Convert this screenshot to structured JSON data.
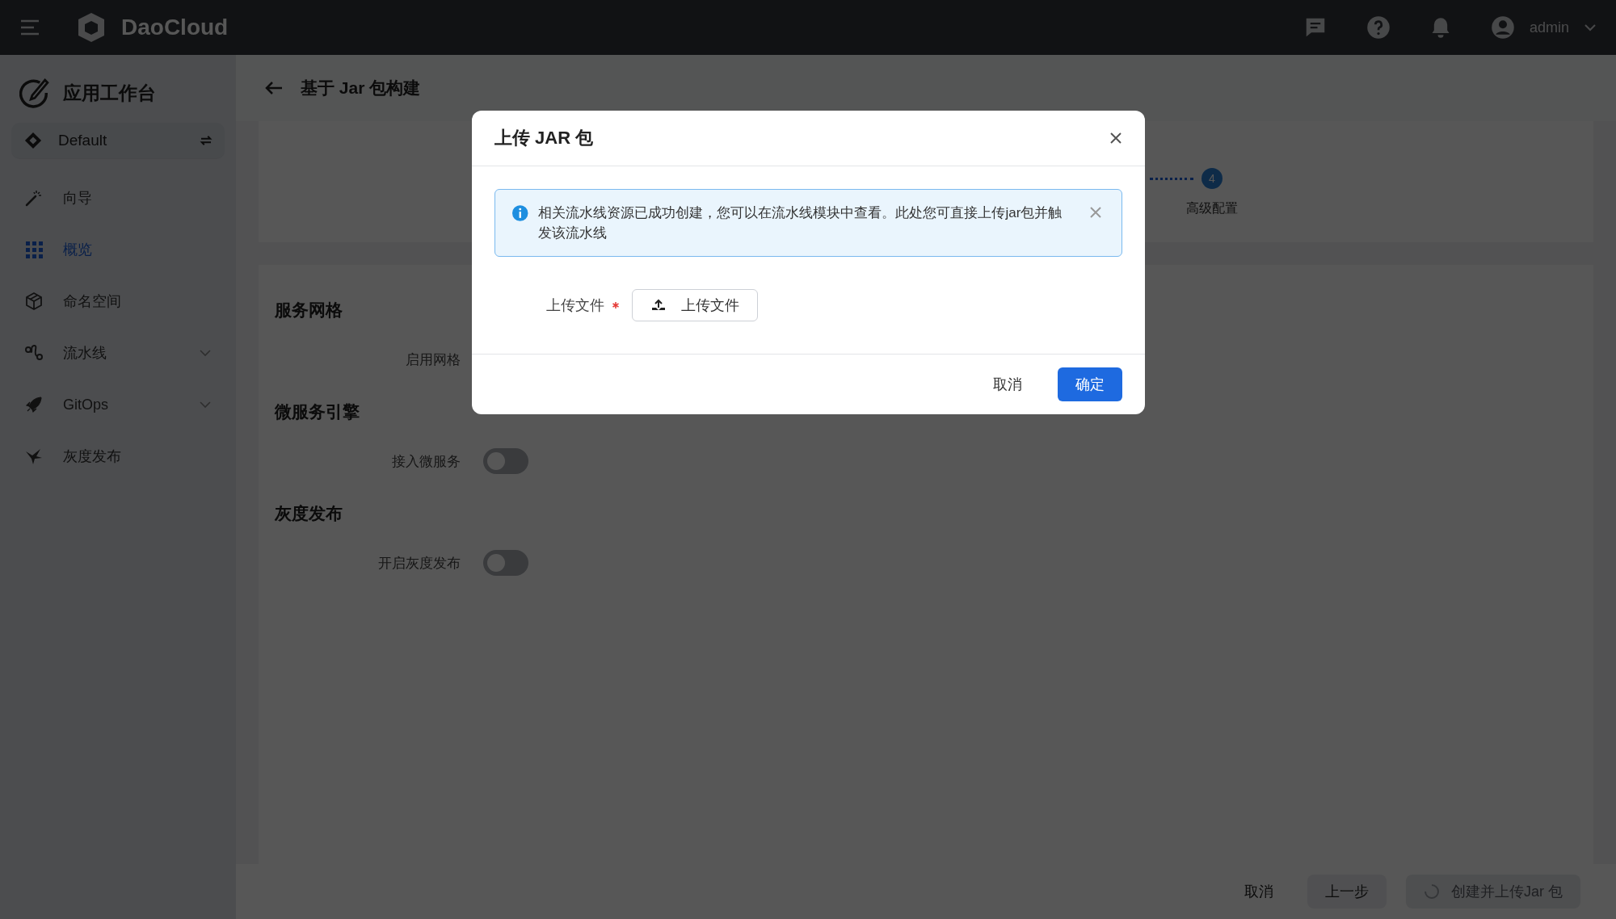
{
  "topbar": {
    "brand": "DaoCloud",
    "user": "admin"
  },
  "sidebar": {
    "title": "应用工作台",
    "workspace": "Default",
    "items": [
      {
        "label": "向导",
        "selected": false,
        "expandable": false
      },
      {
        "label": "概览",
        "selected": true,
        "expandable": false
      },
      {
        "label": "命名空间",
        "selected": false,
        "expandable": false
      },
      {
        "label": "流水线",
        "selected": false,
        "expandable": true
      },
      {
        "label": "GitOps",
        "selected": false,
        "expandable": true
      },
      {
        "label": "灰度发布",
        "selected": false,
        "expandable": false
      }
    ]
  },
  "page": {
    "title": "基于 Jar 包构建",
    "stepper": {
      "steps": [
        {
          "number": "4",
          "label": "高级配置",
          "selected": true
        }
      ]
    },
    "sections": [
      {
        "title": "服务网格",
        "fields": [
          {
            "label": "启用网格"
          }
        ]
      },
      {
        "title": "微服务引擎",
        "fields": [
          {
            "label": "接入微服务",
            "on": false
          }
        ]
      },
      {
        "title": "灰度发布",
        "fields": [
          {
            "label": "开启灰度发布",
            "on": false
          }
        ]
      }
    ]
  },
  "footer": {
    "cancel": "取消",
    "back": "上一步",
    "submit": {
      "label": "创建并上传Jar 包",
      "disabled": true,
      "loading": true
    }
  },
  "modal": {
    "title": "上传 JAR 包",
    "alert": "相关流水线资源已成功创建，您可以在流水线模块中查看。此处您可直接上传jar包并触发该流水线",
    "field_label": "上传文件",
    "required": true,
    "upload_button": "上传文件",
    "cancel": "取消",
    "ok": "确定"
  }
}
